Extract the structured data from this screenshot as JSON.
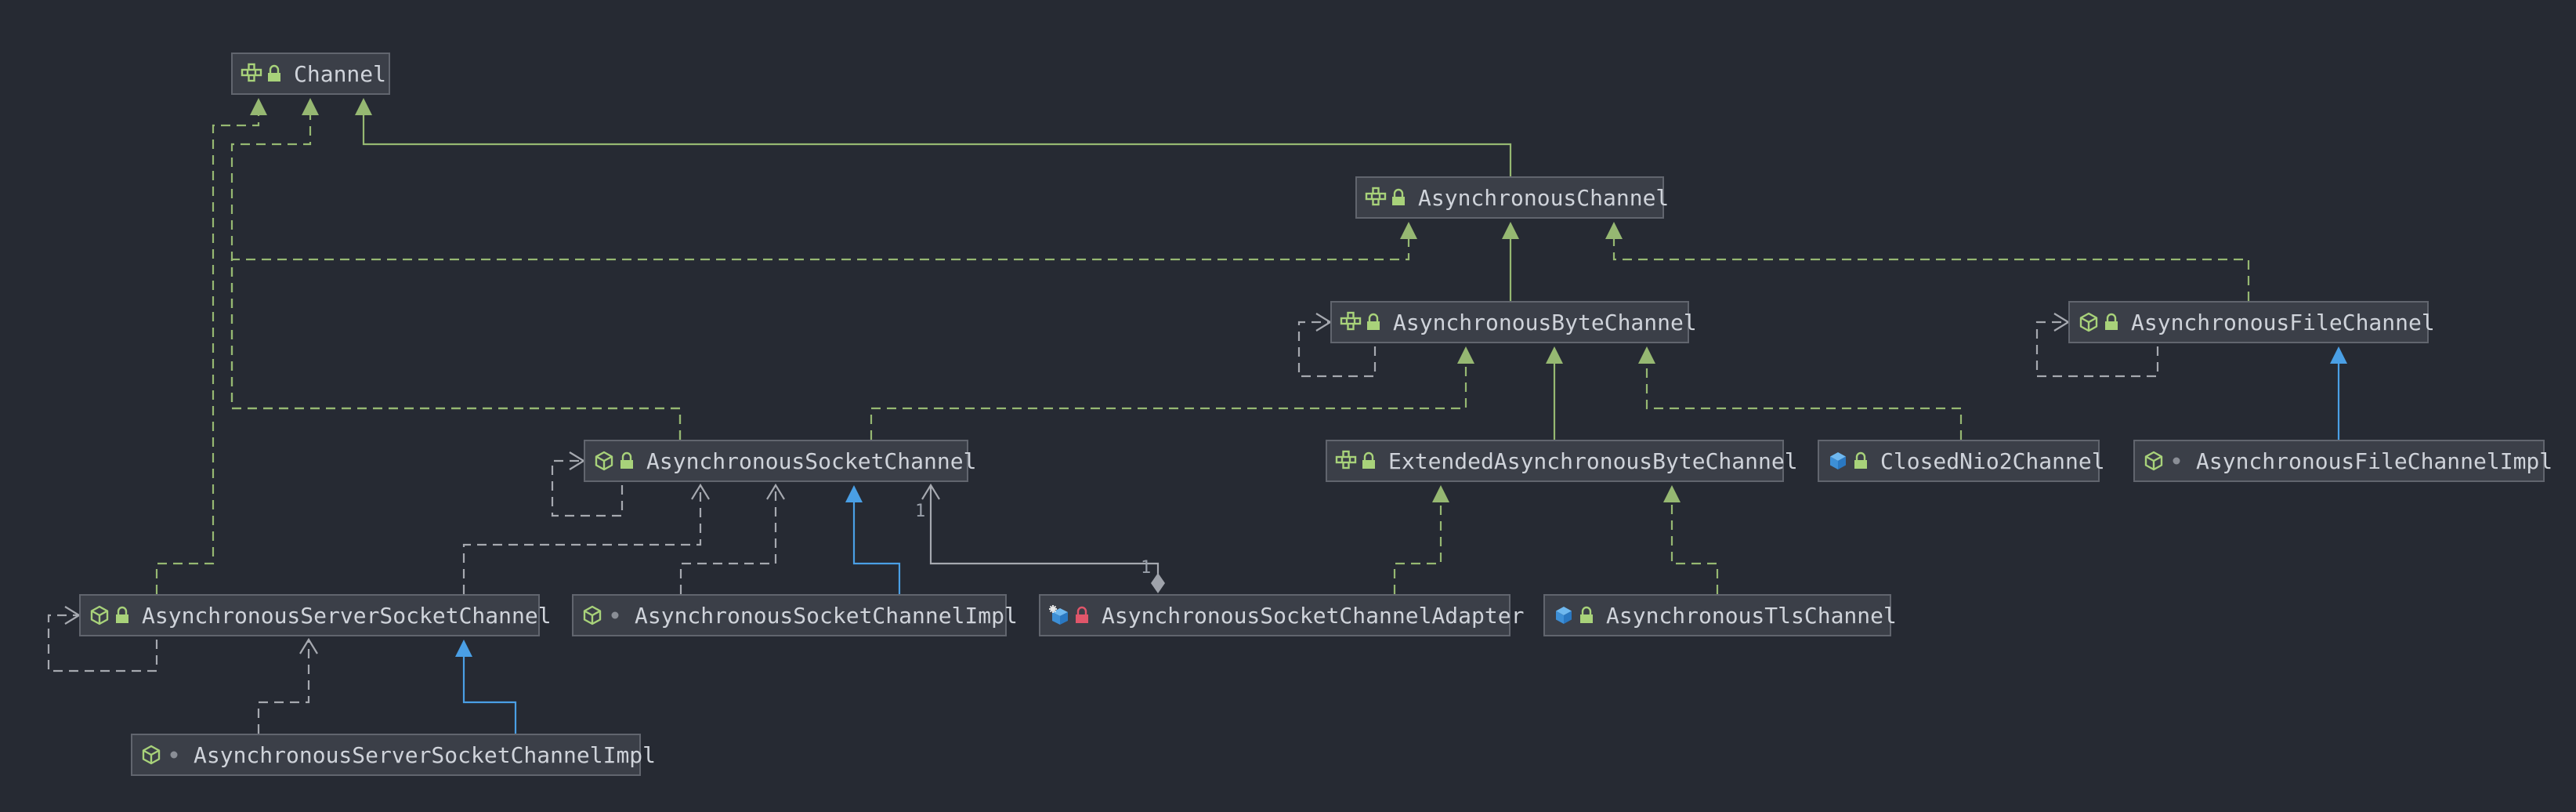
{
  "nodes": [
    {
      "id": "channel",
      "label": "Channel",
      "kind": "interface",
      "access": "lock"
    },
    {
      "id": "async_channel",
      "label": "AsynchronousChannel",
      "kind": "interface",
      "access": "lock"
    },
    {
      "id": "async_byte_channel",
      "label": "AsynchronousByteChannel",
      "kind": "interface",
      "access": "lock"
    },
    {
      "id": "async_file_channel",
      "label": "AsynchronousFileChannel",
      "kind": "abstract-class",
      "access": "lock"
    },
    {
      "id": "async_socket_channel",
      "label": "AsynchronousSocketChannel",
      "kind": "abstract-class",
      "access": "lock"
    },
    {
      "id": "ext_async_byte_channel",
      "label": "ExtendedAsynchronousByteChannel",
      "kind": "interface",
      "access": "lock"
    },
    {
      "id": "closed_nio2_channel",
      "label": "ClosedNio2Channel",
      "kind": "class",
      "access": "lock"
    },
    {
      "id": "async_file_channel_impl",
      "label": "AsynchronousFileChannelImpl",
      "kind": "abstract-class",
      "access": "package"
    },
    {
      "id": "async_server_socket_channel",
      "label": "AsynchronousServerSocketChannel",
      "kind": "abstract-class",
      "access": "lock"
    },
    {
      "id": "async_socket_channel_impl",
      "label": "AsynchronousSocketChannelImpl",
      "kind": "abstract-class",
      "access": "package"
    },
    {
      "id": "async_socket_channel_adapter",
      "label": "AsynchronousSocketChannelAdapter",
      "kind": "class-static",
      "access": "private"
    },
    {
      "id": "async_tls_channel",
      "label": "AsynchronousTlsChannel",
      "kind": "class",
      "access": "lock"
    },
    {
      "id": "async_server_socket_channel_impl",
      "label": "AsynchronousServerSocketChannelImpl",
      "kind": "abstract-class",
      "access": "package"
    }
  ],
  "edges": [
    {
      "from": "async_channel",
      "to": "channel",
      "type": "extends-interface"
    },
    {
      "from": "async_byte_channel",
      "to": "async_channel",
      "type": "extends-interface"
    },
    {
      "from": "async_file_channel",
      "to": "async_channel",
      "type": "implements"
    },
    {
      "from": "async_socket_channel",
      "to": "async_channel",
      "type": "implements"
    },
    {
      "from": "async_socket_channel",
      "to": "async_byte_channel",
      "type": "implements"
    },
    {
      "from": "async_socket_channel",
      "to": "channel",
      "type": "implements"
    },
    {
      "from": "ext_async_byte_channel",
      "to": "async_byte_channel",
      "type": "extends-interface"
    },
    {
      "from": "closed_nio2_channel",
      "to": "async_byte_channel",
      "type": "implements"
    },
    {
      "from": "async_file_channel_impl",
      "to": "async_file_channel",
      "type": "extends"
    },
    {
      "from": "async_server_socket_channel",
      "to": "channel",
      "type": "implements"
    },
    {
      "from": "async_server_socket_channel",
      "to": "async_socket_channel",
      "type": "dependency"
    },
    {
      "from": "async_socket_channel_impl",
      "to": "async_socket_channel",
      "type": "extends"
    },
    {
      "from": "async_socket_channel_impl",
      "to": "async_socket_channel",
      "type": "dependency"
    },
    {
      "from": "async_socket_channel_adapter",
      "to": "async_socket_channel",
      "type": "composition",
      "source_multiplicity": "1",
      "target_multiplicity": "1"
    },
    {
      "from": "async_socket_channel_adapter",
      "to": "ext_async_byte_channel",
      "type": "implements"
    },
    {
      "from": "async_tls_channel",
      "to": "ext_async_byte_channel",
      "type": "implements"
    },
    {
      "from": "async_server_socket_channel_impl",
      "to": "async_server_socket_channel",
      "type": "extends"
    },
    {
      "from": "async_server_socket_channel_impl",
      "to": "async_server_socket_channel",
      "type": "dependency"
    },
    {
      "from": "async_byte_channel",
      "to": "async_byte_channel",
      "type": "self-dependency"
    },
    {
      "from": "async_file_channel",
      "to": "async_file_channel",
      "type": "self-dependency"
    },
    {
      "from": "async_socket_channel",
      "to": "async_socket_channel",
      "type": "self-dependency"
    },
    {
      "from": "async_server_socket_channel",
      "to": "async_server_socket_channel",
      "type": "self-dependency"
    }
  ],
  "colors": {
    "background": "#262a33",
    "node_fill": "#3b3f48",
    "node_border": "#61656e",
    "text": "#cfd3da",
    "interface_edge": "#96b872",
    "class_edge": "#4a9fe5",
    "dependency_edge": "#a6a9b0"
  }
}
